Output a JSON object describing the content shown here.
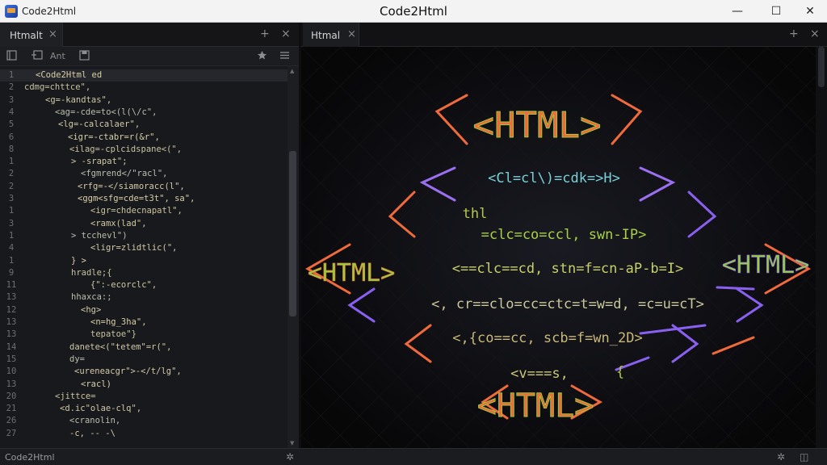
{
  "window": {
    "app_name": "Code2Html",
    "title": "Code2Html",
    "controls": {
      "minimize": "—",
      "maximize": "☐",
      "close": "✕"
    }
  },
  "left_pane": {
    "tab_label": "Htmalt",
    "tab_close": "×",
    "new_tab": "+",
    "close_pane": "×",
    "toolbar_label": "Ant",
    "lines": [
      {
        "n": "1",
        "t": "<Code2Html ed",
        "indent": 44,
        "active": true
      },
      {
        "n": "2",
        "t": "cdmg=chttce\",",
        "indent": 30
      },
      {
        "n": "3",
        "t": "<g=-kandtas\",",
        "indent": 56
      },
      {
        "n": "4",
        "t": "<ag=-cde=to<(l(\\/c\",",
        "indent": 68
      },
      {
        "n": "5",
        "t": "<lg=-calcalaer\",",
        "indent": 72
      },
      {
        "n": "6",
        "t": "<igr=-ctabr=r(&r\",",
        "indent": 84
      },
      {
        "n": "8",
        "t": "<ilag=-cplcidspane<(\",",
        "indent": 86
      },
      {
        "n": "1",
        "t": "> -srapat\";",
        "indent": 88
      },
      {
        "n": "2",
        "t": "<fgmrend</\"racl\",",
        "indent": 100
      },
      {
        "n": "2",
        "t": "<rfg=-</siamoracc(l\",",
        "indent": 96
      },
      {
        "n": "3",
        "t": "<ggm<sfg=cde=t3t\", sa\",",
        "indent": 96
      },
      {
        "n": "1",
        "t": "<igr=chdecnapatl\",",
        "indent": 112
      },
      {
        "n": "3",
        "t": "<ramx(lad\",",
        "indent": 112
      },
      {
        "n": "1",
        "t": "> tcchevl\")",
        "indent": 88
      },
      {
        "n": "4",
        "t": "<ligr=zlidtlic(\",",
        "indent": 112
      },
      {
        "n": "1",
        "t": "} >",
        "indent": 88
      },
      {
        "n": "9",
        "t": "hradle;{",
        "indent": 88
      },
      {
        "n": "11",
        "t": "{\":-ecorclc\",",
        "indent": 112
      },
      {
        "n": "13",
        "t": "hhaxca:;",
        "indent": 88
      },
      {
        "n": "12",
        "t": "<hg>",
        "indent": 100
      },
      {
        "n": "13",
        "t": "<n=hg_3ha\",",
        "indent": 112
      },
      {
        "n": "13",
        "t": "tepatoe\"}",
        "indent": 112
      },
      {
        "n": "14",
        "t": "danete<(\"tetem\"=r(\",",
        "indent": 86
      },
      {
        "n": "15",
        "t": "dy=",
        "indent": 86
      },
      {
        "n": "10",
        "t": "<ureneacgr\">-</t/lg\",",
        "indent": 92
      },
      {
        "n": "13",
        "t": "<racl)",
        "indent": 100
      },
      {
        "n": "20",
        "t": "<jittce=",
        "indent": 68
      },
      {
        "n": "21",
        "t": "<d.ic\"olae-clq\",",
        "indent": 74
      },
      {
        "n": "26",
        "t": "<cranolin,",
        "indent": 86
      },
      {
        "n": "27",
        "t": "-c, -- -\\",
        "indent": 86
      }
    ]
  },
  "right_pane": {
    "tab_label": "Htmal",
    "tab_close": "×",
    "new_tab": "+",
    "close_pane": "×",
    "art": {
      "top_word": "<HTML>",
      "bottom_word": "<HTML>",
      "left_word": "<HTML>",
      "right_word": "<HTML>",
      "rows": [
        "<Cl=cl\\)=cdk=>H>",
        "thl",
        "=clc=co=ccl, swn-IP>",
        "<==clc==cd, stn=f=cn-aP-b=I>",
        "<, cr==clo=cc=ctc=t=w=d, =c=u=cT>",
        "<,{co==cc, scb=f=wn_2D>",
        "<v===s,",
        "{"
      ]
    }
  },
  "status_bar": {
    "text": "Code2Html"
  }
}
